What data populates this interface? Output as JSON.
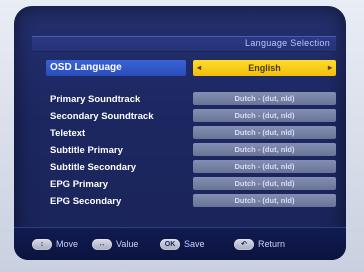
{
  "title": "Language Selection",
  "osd": {
    "label": "OSD Language",
    "value": "English",
    "left_arrow": "◂",
    "right_arrow": "▸"
  },
  "rows": [
    {
      "label": "Primary Soundtrack",
      "value": "Dutch - (dut, nld)"
    },
    {
      "label": "Secondary Soundtrack",
      "value": "Dutch - (dut, nld)"
    },
    {
      "label": "Teletext",
      "value": "Dutch - (dut, nld)"
    },
    {
      "label": "Subtitle Primary",
      "value": "Dutch - (dut, nld)"
    },
    {
      "label": "Subtitle Secondary",
      "value": "Dutch - (dut, nld)"
    },
    {
      "label": "EPG Primary",
      "value": "Dutch - (dut, nld)"
    },
    {
      "label": "EPG Secondary",
      "value": "Dutch - (dut, nld)"
    }
  ],
  "footer": {
    "move": {
      "icon": "↕",
      "label": "Move"
    },
    "value": {
      "icon": "↔",
      "label": "Value"
    },
    "save": {
      "icon": "OK",
      "label": "Save"
    },
    "return": {
      "icon": "↶",
      "label": "Return"
    }
  }
}
